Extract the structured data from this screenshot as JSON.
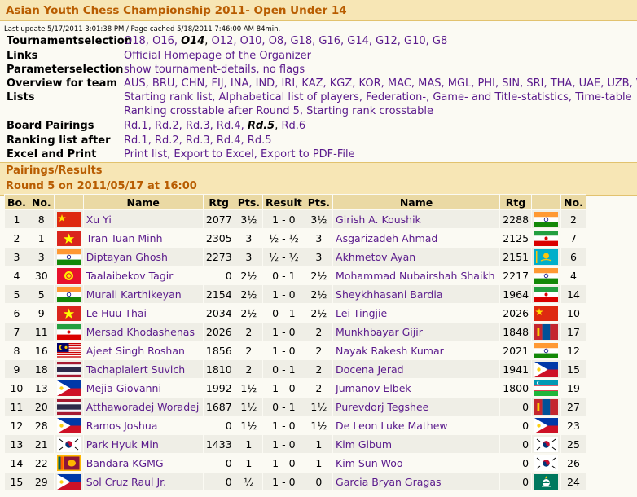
{
  "title": "Asian Youth Chess Championship 2011- Open Under 14",
  "update_line": "Last update 5/17/2011 3:01:38 PM / Page cached 5/18/2011 7:46:00 AM 84min.",
  "info": {
    "tournament": {
      "label": "Tournamentselection",
      "items": [
        "O18,",
        "O16,",
        "O14",
        ",",
        "O12,",
        "O10,",
        "O8,",
        "G18,",
        "G16,",
        "G14,",
        "G12,",
        "G10,",
        "G8"
      ]
    },
    "links": {
      "label": "Links",
      "value": "Official Homepage of the Organizer"
    },
    "params": {
      "label": "Parameterselection",
      "value": "show tournament-details, no flags"
    },
    "teams": {
      "label": "Overview for team",
      "value": "AUS, BRU, CHN, FIJ, INA, IND, IRI, KAZ, KGZ, KOR, MAC, MAS, MGL, PHI, SIN, SRI, THA, UAE, UZB, VIE"
    },
    "lists": {
      "label": "Lists",
      "line1": "Starting rank list, Alphabetical list of players, Federation-, Game- and Title-statistics, Time-table",
      "line2": "Ranking crosstable after Round 5, Starting rank crosstable"
    },
    "board": {
      "label": "Board Pairings",
      "items": [
        "Rd.1,",
        "Rd.2,",
        "Rd.3,",
        "Rd.4,",
        "Rd.5",
        ",",
        "Rd.6"
      ]
    },
    "ranking": {
      "label": "Ranking list after",
      "value": "Rd.1, Rd.2, Rd.3, Rd.4, Rd.5"
    },
    "excel": {
      "label": "Excel and Print",
      "value": "Print list, Export to Excel, Export to PDF-File"
    }
  },
  "section_pairings": "Pairings/Results",
  "section_round": "Round 5 on 2011/05/17 at 16:00",
  "columns": [
    "Bo.",
    "No.",
    "",
    "Name",
    "Rtg",
    "Pts.",
    "Result",
    "Pts.",
    "Name",
    "Rtg",
    "",
    "No."
  ],
  "pairings": [
    {
      "bo": "1",
      "no1": "8",
      "flag1": "CHN",
      "name1": "Xu Yi",
      "rtg1": "2077",
      "pts1": "3½",
      "result": "1 - 0",
      "pts2": "3½",
      "name2": "Girish A. Koushik",
      "rtg2": "2288",
      "flag2": "IND",
      "no2": "2"
    },
    {
      "bo": "2",
      "no1": "1",
      "flag1": "VIE",
      "name1": "Tran Tuan Minh",
      "rtg1": "2305",
      "pts1": "3",
      "result": "½ - ½",
      "pts2": "3",
      "name2": "Asgarizadeh Ahmad",
      "rtg2": "2125",
      "flag2": "IRI",
      "no2": "7"
    },
    {
      "bo": "3",
      "no1": "3",
      "flag1": "IND",
      "name1": "Diptayan Ghosh",
      "rtg1": "2273",
      "pts1": "3",
      "result": "½ - ½",
      "pts2": "3",
      "name2": "Akhmetov Ayan",
      "rtg2": "2151",
      "flag2": "KAZ",
      "no2": "6"
    },
    {
      "bo": "4",
      "no1": "30",
      "flag1": "KGZ",
      "name1": "Taalaibekov Tagir",
      "rtg1": "0",
      "pts1": "2½",
      "result": "0 - 1",
      "pts2": "2½",
      "name2": "Mohammad Nubairshah Shaikh",
      "rtg2": "2217",
      "flag2": "IND",
      "no2": "4"
    },
    {
      "bo": "5",
      "no1": "5",
      "flag1": "IND",
      "name1": "Murali Karthikeyan",
      "rtg1": "2154",
      "pts1": "2½",
      "result": "1 - 0",
      "pts2": "2½",
      "name2": "Sheykhhasani Bardia",
      "rtg2": "1964",
      "flag2": "IRI",
      "no2": "14"
    },
    {
      "bo": "6",
      "no1": "9",
      "flag1": "VIE",
      "name1": "Le Huu Thai",
      "rtg1": "2034",
      "pts1": "2½",
      "result": "0 - 1",
      "pts2": "2½",
      "name2": "Lei Tingjie",
      "rtg2": "2026",
      "flag2": "CHN",
      "no2": "10"
    },
    {
      "bo": "7",
      "no1": "11",
      "flag1": "IRI",
      "name1": "Mersad Khodashenas",
      "rtg1": "2026",
      "pts1": "2",
      "result": "1 - 0",
      "pts2": "2",
      "name2": "Munkhbayar Gijir",
      "rtg2": "1848",
      "flag2": "MGL",
      "no2": "17"
    },
    {
      "bo": "8",
      "no1": "16",
      "flag1": "MAS",
      "name1": "Ajeet Singh Roshan",
      "rtg1": "1856",
      "pts1": "2",
      "result": "1 - 0",
      "pts2": "2",
      "name2": "Nayak Rakesh Kumar",
      "rtg2": "2021",
      "flag2": "IND",
      "no2": "12"
    },
    {
      "bo": "9",
      "no1": "18",
      "flag1": "THA",
      "name1": "Tachaplalert Suvich",
      "rtg1": "1810",
      "pts1": "2",
      "result": "0 - 1",
      "pts2": "2",
      "name2": "Docena Jerad",
      "rtg2": "1941",
      "flag2": "PHI",
      "no2": "15"
    },
    {
      "bo": "10",
      "no1": "13",
      "flag1": "PHI",
      "name1": "Mejia Giovanni",
      "rtg1": "1992",
      "pts1": "1½",
      "result": "1 - 0",
      "pts2": "2",
      "name2": "Jumanov Elbek",
      "rtg2": "1800",
      "flag2": "UZB",
      "no2": "19"
    },
    {
      "bo": "11",
      "no1": "20",
      "flag1": "THA",
      "name1": "Atthaworadej Woradej",
      "rtg1": "1687",
      "pts1": "1½",
      "result": "0 - 1",
      "pts2": "1½",
      "name2": "Purevdorj Tegshee",
      "rtg2": "0",
      "flag2": "MGL",
      "no2": "27"
    },
    {
      "bo": "12",
      "no1": "28",
      "flag1": "PHI",
      "name1": "Ramos Joshua",
      "rtg1": "0",
      "pts1": "1½",
      "result": "1 - 0",
      "pts2": "1½",
      "name2": "De Leon Luke Mathew",
      "rtg2": "0",
      "flag2": "PHI",
      "no2": "23"
    },
    {
      "bo": "13",
      "no1": "21",
      "flag1": "KOR",
      "name1": "Park Hyuk Min",
      "rtg1": "1433",
      "pts1": "1",
      "result": "1 - 0",
      "pts2": "1",
      "name2": "Kim Gibum",
      "rtg2": "0",
      "flag2": "KOR",
      "no2": "25"
    },
    {
      "bo": "14",
      "no1": "22",
      "flag1": "SRI",
      "name1": "Bandara KGMG",
      "rtg1": "0",
      "pts1": "1",
      "result": "1 - 0",
      "pts2": "1",
      "name2": "Kim Sun Woo",
      "rtg2": "0",
      "flag2": "KOR",
      "no2": "26"
    },
    {
      "bo": "15",
      "no1": "29",
      "flag1": "PHI",
      "name1": "Sol Cruz Raul Jr.",
      "rtg1": "0",
      "pts1": "½",
      "result": "1 - 0",
      "pts2": "0",
      "name2": "Garcia Bryan Gragas",
      "rtg2": "0",
      "flag2": "MAC",
      "no2": "24"
    }
  ]
}
